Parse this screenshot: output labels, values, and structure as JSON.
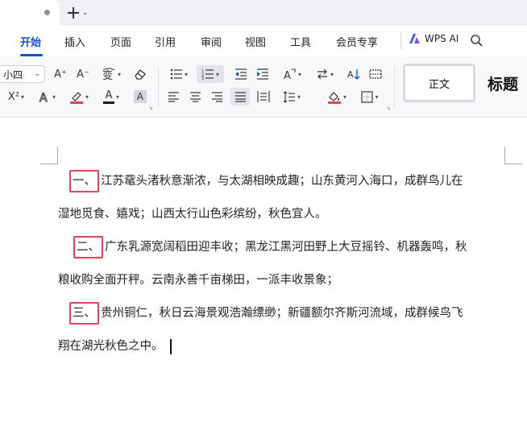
{
  "titlebar": {
    "new_tab_symbol": "+"
  },
  "menu": {
    "items": [
      "开始",
      "插入",
      "页面",
      "引用",
      "审阅",
      "视图",
      "工具",
      "会员专享"
    ],
    "active": "开始",
    "wps_ai_label": "WPS AI"
  },
  "ribbon": {
    "font_size": "小四",
    "style_normal": "正文",
    "style_heading": "标题",
    "buttons": {
      "grow_font": "A⁺",
      "shrink_font": "A⁻",
      "phonetic": "ʷᵉⁿ",
      "superscript": "X²",
      "font_color_letter": "A",
      "char_shade_letter": "A"
    },
    "icons": [
      "eraser-icon",
      "bullet-list-icon",
      "numbered-list-icon",
      "outdent-icon",
      "indent-icon",
      "text-direction-icon",
      "line-swap-icon",
      "sort-icon",
      "table-borders-icon",
      "align-left-icon",
      "align-center-icon",
      "align-right-icon",
      "justify-icon",
      "distributed-icon",
      "line-spacing-icon",
      "shading-icon",
      "border-icon"
    ],
    "accent_color": "#1a4fd0",
    "font_color_bar": "#1a1a1a",
    "highlight_bar": "#e0435a"
  },
  "document": {
    "marker_color": "#e0435a",
    "paragraphs": [
      {
        "marker": "一、",
        "line1": "江苏鼋头渚秋意渐浓，与太湖相映成趣；山东黄河入海口，成群鸟儿在",
        "line2": "湿地觅食、嬉戏；山西太行山色彩缤纷，秋色宜人。"
      },
      {
        "marker": "二、",
        "line1": "广东乳源宽阔稻田迎丰收；黑龙江黑河田野上大豆摇铃、机器轰鸣，秋",
        "line2": "粮收购全面开秤。云南永善千亩梯田，一派丰收景象；"
      },
      {
        "marker": "三、",
        "line1": "贵州铜仁，秋日云海景观浩瀚缥缈；新疆额尔齐斯河流域，成群候鸟飞",
        "line2": "翔在湖光秋色之中。"
      }
    ]
  }
}
